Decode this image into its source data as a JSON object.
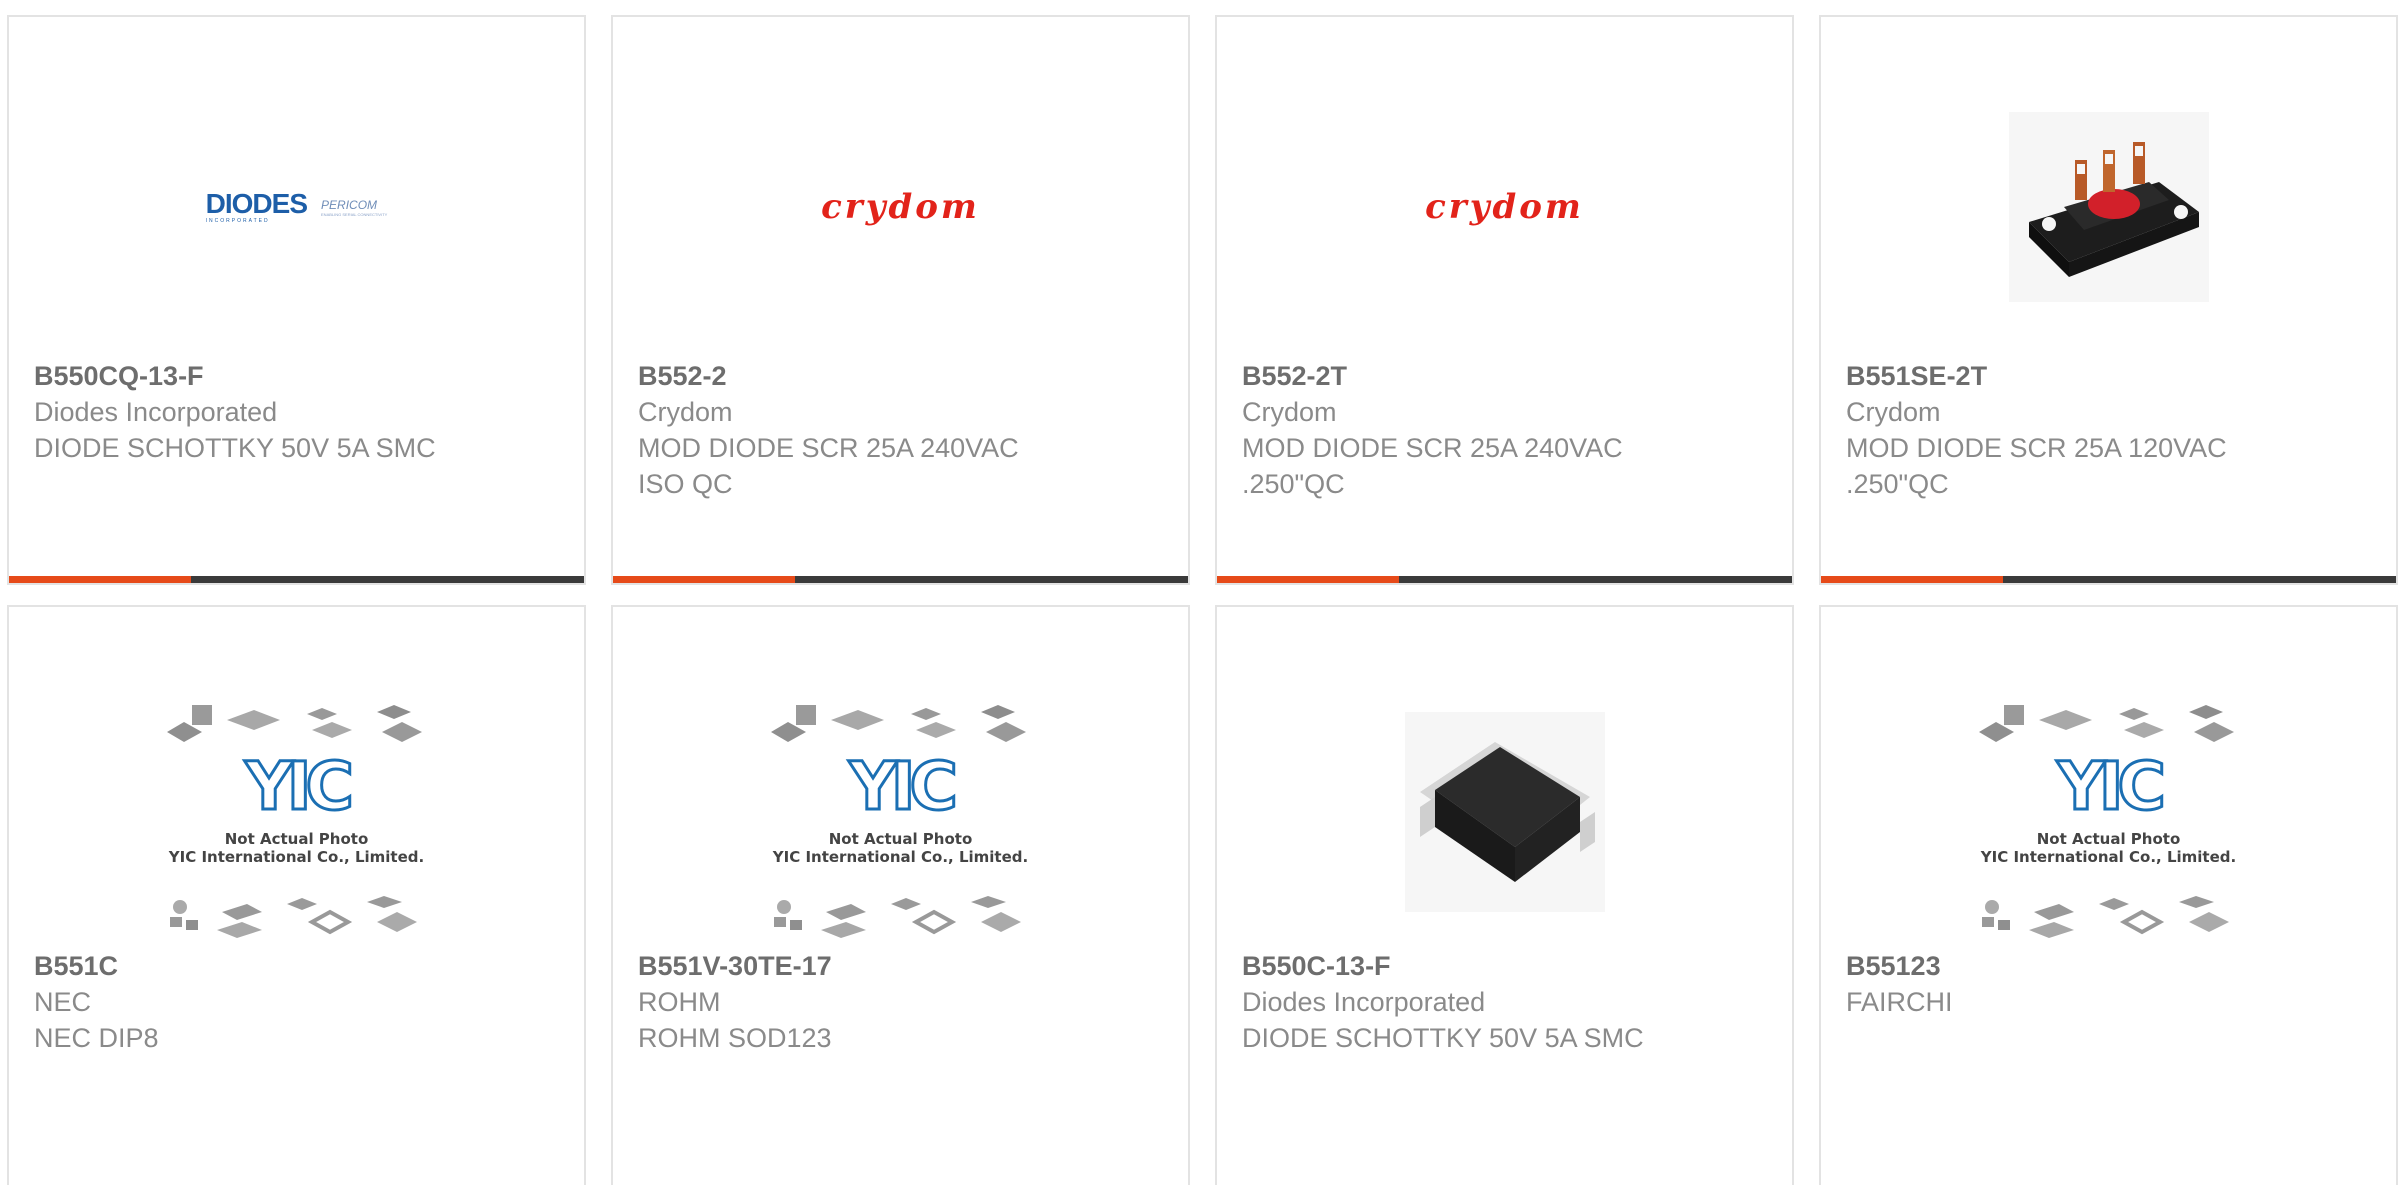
{
  "products": [
    {
      "part_number": "B550CQ-13-F",
      "manufacturer": "Diodes Incorporated",
      "description_lines": [
        "DIODE SCHOTTKY 50V 5A SMC"
      ],
      "image": "diodes-pericom-logo"
    },
    {
      "part_number": "B552-2",
      "manufacturer": "Crydom",
      "description_lines": [
        "MOD DIODE SCR 25A 240VAC",
        "ISO QC"
      ],
      "image": "crydom-logo"
    },
    {
      "part_number": "B552-2T",
      "manufacturer": "Crydom",
      "description_lines": [
        "MOD DIODE SCR 25A 240VAC",
        ".250\"QC"
      ],
      "image": "crydom-logo"
    },
    {
      "part_number": "B551SE-2T",
      "manufacturer": "Crydom",
      "description_lines": [
        "MOD DIODE SCR 25A 120VAC",
        ".250\"QC"
      ],
      "image": "scr-module-photo"
    },
    {
      "part_number": "B551C",
      "manufacturer": "NEC",
      "description_lines": [
        "NEC DIP8"
      ],
      "image": "yic-placeholder"
    },
    {
      "part_number": "B551V-30TE-17",
      "manufacturer": "ROHM",
      "description_lines": [
        "ROHM SOD123"
      ],
      "image": "yic-placeholder"
    },
    {
      "part_number": "B550C-13-F",
      "manufacturer": "Diodes Incorporated",
      "description_lines": [
        "DIODE SCHOTTKY 50V 5A SMC"
      ],
      "image": "smc-diode-photo"
    },
    {
      "part_number": "B55123",
      "manufacturer": "FAIRCHI",
      "description_lines": [],
      "image": "yic-placeholder"
    }
  ],
  "logos": {
    "diodes_main": "DIODES",
    "diodes_sub": "INCORPORATED",
    "pericom_main": "PERICOM",
    "pericom_sub": "ENABLING SERIAL CONNECTIVITY",
    "crydom": "crydom"
  },
  "placeholder": {
    "letters": "YIC",
    "line1": "Not Actual Photo",
    "line2": "YIC International Co., Limited."
  },
  "colors": {
    "accent": "#e64a19",
    "bar": "#3a3a3a",
    "border": "#e3e3e3",
    "crydom_red": "#e2231a",
    "diodes_blue": "#1d5ea8",
    "yic_blue": "#1b6fb3"
  }
}
